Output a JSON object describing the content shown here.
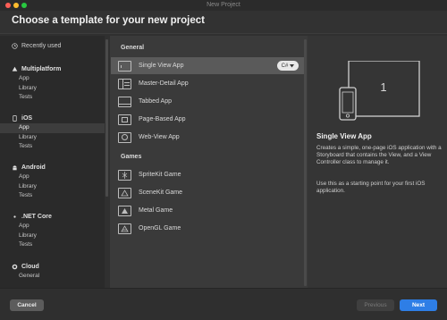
{
  "window": {
    "title": "New Project"
  },
  "header": {
    "title": "Choose a template for your new project"
  },
  "sidebar": {
    "recent": "Recently used",
    "groups": [
      {
        "name": "Multiplatform",
        "icon": "multiplatform-icon",
        "items": [
          "App",
          "Library",
          "Tests"
        ]
      },
      {
        "name": "iOS",
        "icon": "ios-icon",
        "items": [
          "App",
          "Library",
          "Tests"
        ],
        "selected_index": 0
      },
      {
        "name": "Android",
        "icon": "android-icon",
        "items": [
          "App",
          "Library",
          "Tests"
        ]
      },
      {
        "name": ".NET Core",
        "icon": "dotnet-icon",
        "items": [
          "App",
          "Library",
          "Tests"
        ]
      },
      {
        "name": "Cloud",
        "icon": "cloud-icon",
        "items": [
          "General"
        ]
      }
    ]
  },
  "templates": {
    "sections": [
      {
        "name": "General",
        "items": [
          "Single View App",
          "Master-Detail App",
          "Tabbed App",
          "Page-Based App",
          "Web-View App"
        ]
      },
      {
        "name": "Games",
        "items": [
          "SpriteKit Game",
          "SceneKit Game",
          "Metal Game",
          "OpenGL Game"
        ]
      }
    ],
    "selected": "Single View App",
    "language": "C#"
  },
  "detail": {
    "preview_number": "1",
    "title": "Single View App",
    "description": "Creates a simple, one-page iOS application with a Storyboard that contains the View, and a View Controller class to manage it.",
    "hint": "Use this as a starting point for your first iOS application."
  },
  "footer": {
    "cancel": "Cancel",
    "previous": "Previous",
    "next": "Next"
  },
  "colors": {
    "accent": "#2e7ee6",
    "close": "#fe5f57",
    "minimize": "#febc2e",
    "maximize": "#28c840"
  }
}
